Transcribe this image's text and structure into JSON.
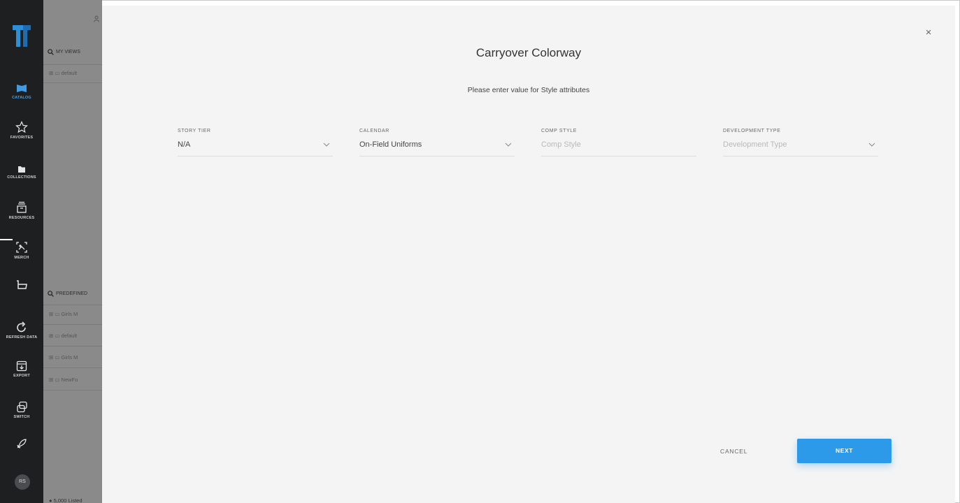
{
  "nav": {
    "items": [
      {
        "label": "CATALOG",
        "icon": "catalog-icon"
      },
      {
        "label": "FAVORITES",
        "icon": "star-icon"
      },
      {
        "label": "COLLECTIONS",
        "icon": "folder-icon"
      },
      {
        "label": "RESOURCES",
        "icon": "resources-icon"
      },
      {
        "label": "MERCH",
        "icon": "merch-icon"
      },
      {
        "label": "",
        "icon": "basket-icon"
      },
      {
        "label": "REFRESH DATA",
        "icon": "refresh-icon"
      },
      {
        "label": "EXPORT",
        "icon": "export-icon"
      },
      {
        "label": "SWITCH",
        "icon": "switch-icon"
      },
      {
        "label": "",
        "icon": "rocket-icon"
      }
    ],
    "avatar": "RS",
    "accent": "#4aa3e8"
  },
  "background_panel": {
    "my_views_label": "MY VIEWS",
    "my_views_items": [
      "default"
    ],
    "predefined_label": "PREDEFINED",
    "predefined_items": [
      "Girls M",
      "default",
      "Girls M",
      "NewFo"
    ],
    "footer": "5,000 Listed"
  },
  "modal": {
    "title": "Carryover Colorway",
    "subtitle": "Please enter value for Style attributes",
    "fields": [
      {
        "label": "STORY TIER",
        "value": "N/A",
        "placeholder": "",
        "type": "select"
      },
      {
        "label": "CALENDAR",
        "value": "On-Field Uniforms",
        "placeholder": "",
        "type": "select"
      },
      {
        "label": "COMP STYLE",
        "value": "",
        "placeholder": "Comp Style",
        "type": "text"
      },
      {
        "label": "DEVELOPMENT TYPE",
        "value": "",
        "placeholder": "Development Type",
        "type": "select"
      }
    ],
    "cancel_label": "CANCEL",
    "next_label": "NEXT",
    "close_symbol": "×",
    "primary_color": "#2d9ae9"
  }
}
